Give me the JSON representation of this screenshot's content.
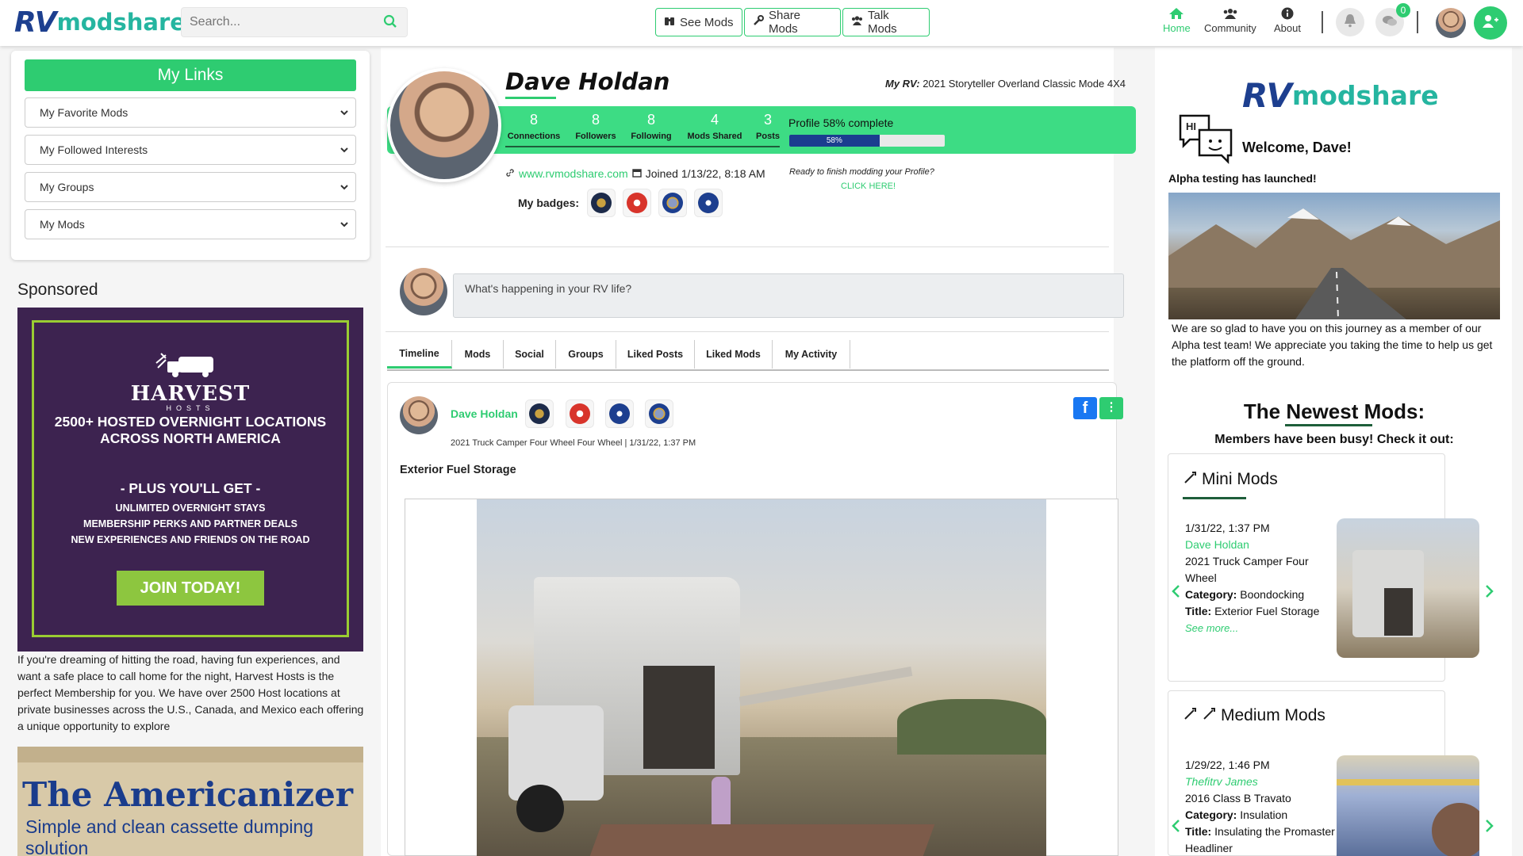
{
  "header": {
    "logo_rv": "RV",
    "logo_text": "modshare",
    "search_placeholder": "Search...",
    "nav_buttons": [
      "See Mods",
      "Share Mods",
      "Talk Mods"
    ],
    "top_nav": [
      "Home",
      "Community",
      "About"
    ],
    "chat_count": "0",
    "accent_color": "#2ecc71"
  },
  "left": {
    "my_links_title": "My Links",
    "links": [
      "My Favorite Mods",
      "My Followed Interests",
      "My Groups",
      "My Mods"
    ],
    "sponsored_title": "Sponsored",
    "ad1": {
      "brand": "HARVEST",
      "brand_sub": "HOSTS",
      "headline1": "2500+ HOSTED OVERNIGHT LOCATIONS",
      "headline2": "ACROSS NORTH AMERICA",
      "plus": "- PLUS YOU'LL GET -",
      "perk1": "UNLIMITED OVERNIGHT STAYS",
      "perk2": "MEMBERSHIP PERKS AND PARTNER DEALS",
      "perk3": "NEW EXPERIENCES AND FRIENDS ON THE ROAD",
      "cta": "JOIN TODAY!"
    },
    "ad1_text": "If you're dreaming of hitting the road, having fun experiences, and want a safe place to call home for the night, Harvest Hosts is the perfect Membership for you. We have over 2500 Host locations at private businesses across the U.S., Canada, and Mexico each offering a unique opportunity to explore",
    "ad2_title": "The Americanizer",
    "ad2_sub": "Simple and clean cassette dumping solution"
  },
  "profile": {
    "name": "Dave Holdan",
    "rv_label": "My RV:",
    "rv_value": "2021 Storyteller Overland Classic Mode 4X4",
    "stats": [
      {
        "n": "8",
        "label": "Connections"
      },
      {
        "n": "8",
        "label": "Followers"
      },
      {
        "n": "8",
        "label": "Following"
      },
      {
        "n": "4",
        "label": "Mods Shared"
      },
      {
        "n": "3",
        "label": "Posts"
      }
    ],
    "complete_label": "Profile 58% complete",
    "complete_pct": 58,
    "complete_text": "58%",
    "website": "www.rvmodshare.com",
    "joined": "Joined 1/13/22, 8:18 AM",
    "finish_prompt": "Ready to finish modding your Profile?",
    "click_here": "CLICK HERE!",
    "badges_label": "My badges:"
  },
  "composer": {
    "placeholder": "What's happening in your RV life?"
  },
  "tabs": [
    "Timeline",
    "Mods",
    "Social",
    "Groups",
    "Liked Posts",
    "Liked Mods",
    "My Activity"
  ],
  "post": {
    "author": "Dave Holdan",
    "meta": "2021 Truck Camper Four Wheel Four Wheel | 1/31/22, 1:37 PM",
    "title": "Exterior Fuel Storage",
    "fb": "f"
  },
  "right": {
    "welcome": "Welcome, Dave!",
    "hi": "HI",
    "alpha": "Alpha testing has launched!",
    "alpha_text": "We are so glad to have you on this journey as a member of our Alpha test team! We appreciate you taking the time to help us get the platform off the ground.",
    "newest_title": "The Newest Mods:",
    "newest_sub": "Members have been busy! Check it out:",
    "mini": {
      "heading": "Mini Mods",
      "date": "1/31/22, 1:37 PM",
      "author": "Dave Holdan",
      "rv": "2021 Truck Camper Four Wheel",
      "category_label": "Category:",
      "category": "Boondocking",
      "title_label": "Title:",
      "title": "Exterior Fuel Storage",
      "see_more": "See more..."
    },
    "medium": {
      "heading": "Medium Mods",
      "date": "1/29/22, 1:46 PM",
      "author": "Thefitrv James",
      "rv": "2016 Class B Travato",
      "category_label": "Category:",
      "category": "Insulation",
      "title_label": "Title:",
      "title": "Insulating the Promaster Headliner"
    }
  }
}
